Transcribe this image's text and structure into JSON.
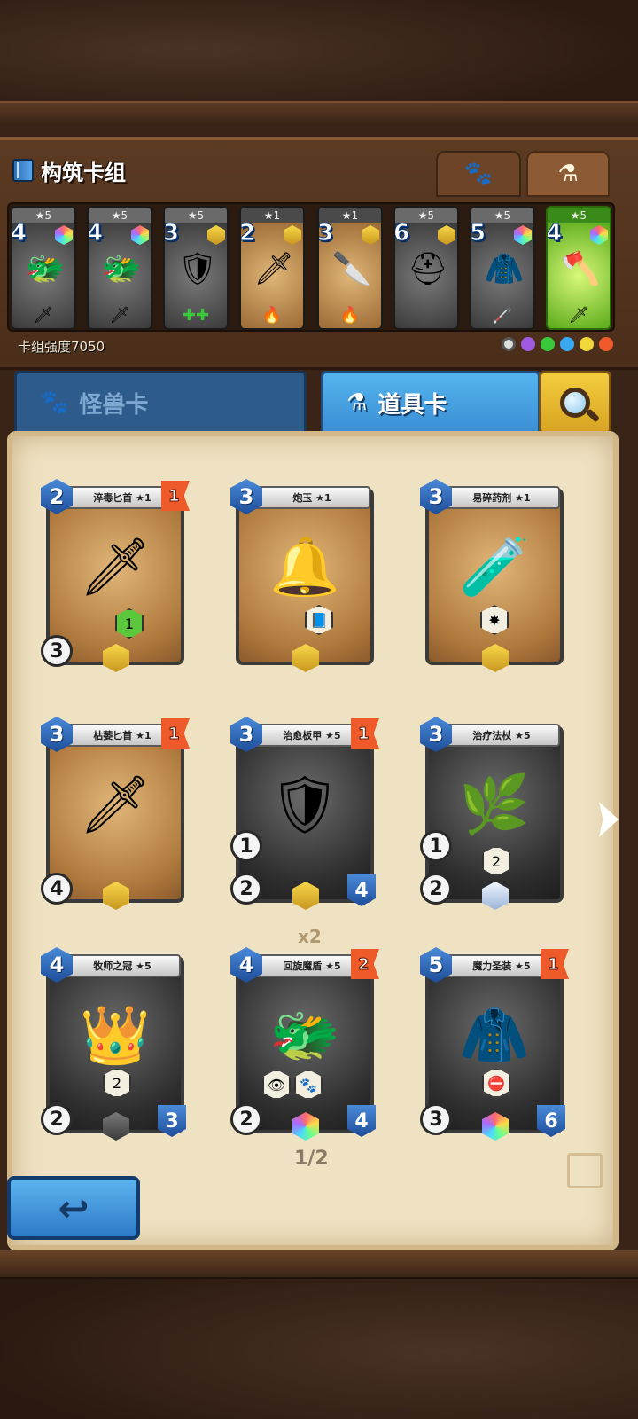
{
  "header": {
    "title": "构筑卡组",
    "deck_strength": "卡组强度7050"
  },
  "top_tabs": [
    {
      "icon": "paw-icon"
    },
    {
      "icon": "flask-icon"
    }
  ],
  "deck": [
    {
      "stars": "★5",
      "cost": "4",
      "art": "dragon-head",
      "bottom": "sword"
    },
    {
      "stars": "★5",
      "cost": "4",
      "art": "dragon-head",
      "bottom": "sword"
    },
    {
      "stars": "★5",
      "cost": "3",
      "art": "armor",
      "bottom": "heal"
    },
    {
      "stars": "★1",
      "cost": "2",
      "art": "green-sword",
      "bottom": "fire"
    },
    {
      "stars": "★1",
      "cost": "3",
      "art": "dagger",
      "bottom": "fire"
    },
    {
      "stars": "★5",
      "cost": "6",
      "art": "helmet",
      "bottom": ""
    },
    {
      "stars": "★5",
      "cost": "5",
      "art": "robe",
      "bottom": "cane"
    },
    {
      "stars": "★5",
      "cost": "4",
      "art": "axe",
      "bottom": "sword"
    }
  ],
  "card_tabs": {
    "monster": "怪兽卡",
    "item": "道具卡"
  },
  "cards": [
    {
      "name": "淬毒匕首 ★1",
      "cost": "2",
      "flag": "1",
      "left_stat": "3",
      "ability": "1"
    },
    {
      "name": "炮玉 ★1",
      "cost": "3",
      "flag": "",
      "left_stat": "",
      "ability": ""
    },
    {
      "name": "易碎药剂 ★1",
      "cost": "3",
      "flag": "",
      "left_stat": "",
      "ability": ""
    },
    {
      "name": "枯萎匕首 ★1",
      "cost": "3",
      "flag": "1",
      "left_stat": "4",
      "ability": ""
    },
    {
      "name": "治愈板甲 ★5",
      "cost": "3",
      "flag": "1",
      "stat1": "1",
      "stat2": "2",
      "right_stat": "4"
    },
    {
      "name": "治疗法杖 ★5",
      "cost": "3",
      "flag": "",
      "stat1": "1",
      "stat2": "2",
      "ability": "2"
    },
    {
      "name": "牧师之冠 ★5",
      "cost": "4",
      "flag": "",
      "left_stat": "2",
      "right_stat": "3",
      "ability": "2"
    },
    {
      "name": "回旋魔盾 ★5",
      "cost": "4",
      "flag": "2",
      "left_stat": "2",
      "right_stat": "4",
      "dup": "x2"
    },
    {
      "name": "魔力圣装 ★5",
      "cost": "5",
      "flag": "1",
      "left_stat": "3",
      "right_stat": "6"
    }
  ],
  "page": "1/2"
}
